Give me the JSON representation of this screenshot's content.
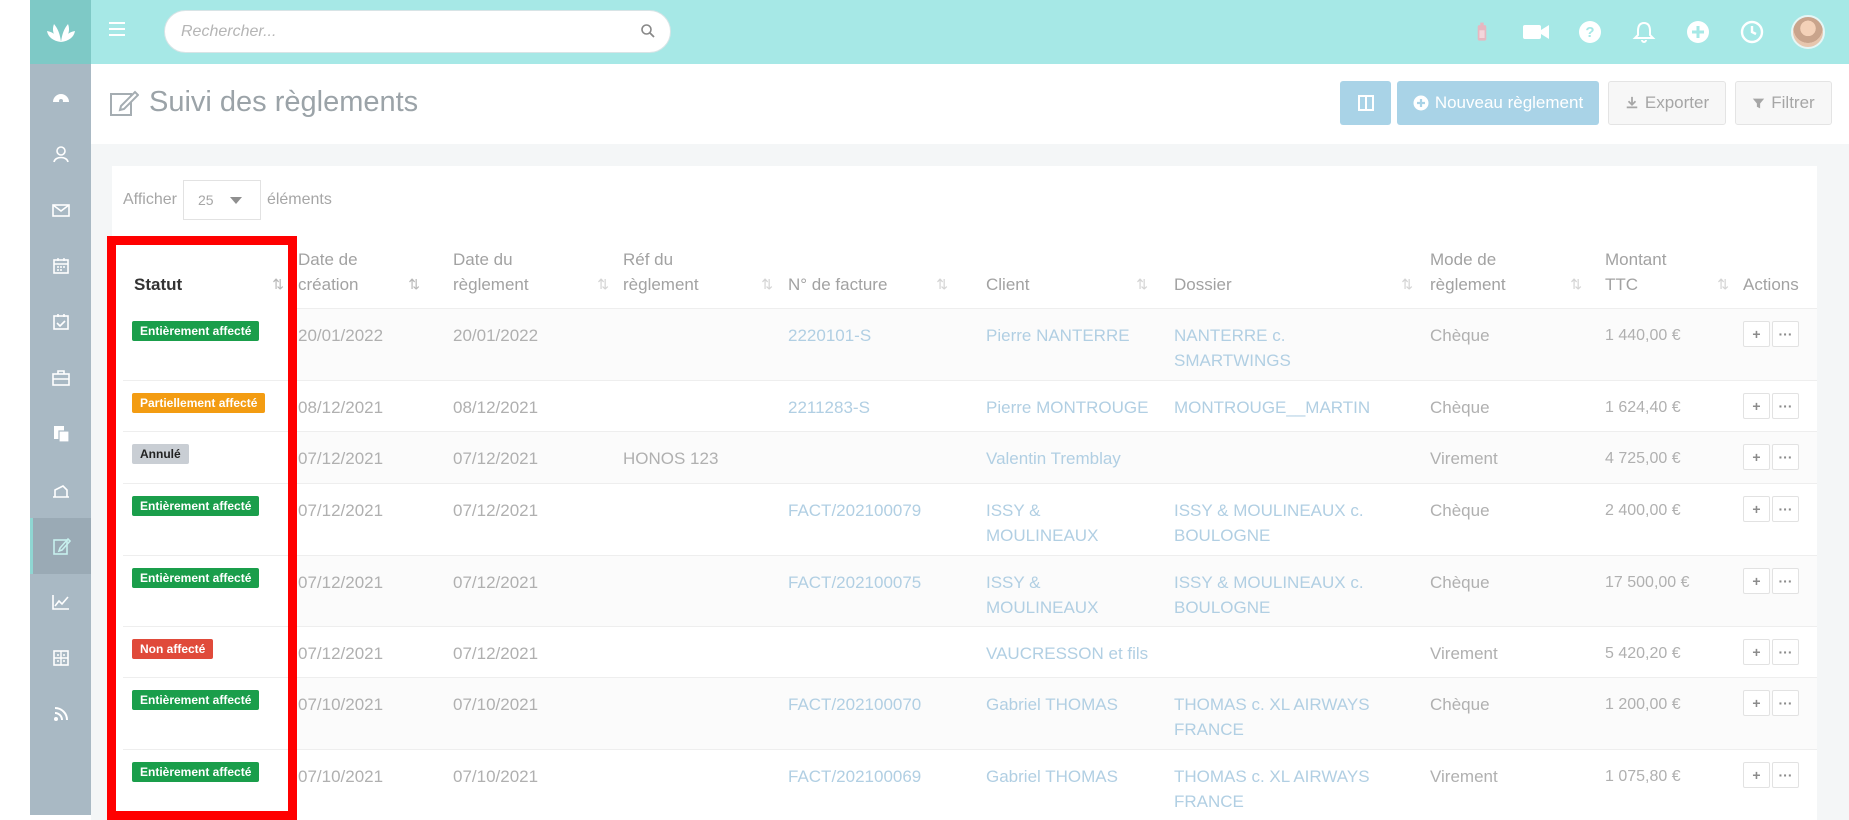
{
  "search": {
    "placeholder": "Rechercher..."
  },
  "page": {
    "title": "Suivi des règlements"
  },
  "toolbar": {
    "new_label": "Nouveau règlement",
    "export_label": "Exporter",
    "filter_label": "Filtrer"
  },
  "length": {
    "before": "Afficher",
    "value": "25",
    "after": "éléments"
  },
  "columns": {
    "statut": "Statut",
    "date_creation_1": "Date de",
    "date_creation_2": "création",
    "date_reglement_1": "Date du",
    "date_reglement_2": "règlement",
    "ref_1": "Réf du",
    "ref_2": "règlement",
    "facture": "N° de facture",
    "client": "Client",
    "dossier": "Dossier",
    "mode_1": "Mode de",
    "mode_2": "règlement",
    "montant_1": "Montant",
    "montant_2": "TTC",
    "actions": "Actions"
  },
  "sort_icon": "⇅",
  "rows": [
    {
      "statut": "Entièrement affecté",
      "statut_color": "#1a9e4b",
      "creation": "20/01/2022",
      "reglement": "20/01/2022",
      "ref": "",
      "facture": "2220101-S",
      "client_1": "Pierre NANTERRE",
      "client_2": "",
      "dossier_1": "NANTERRE c.",
      "dossier_2": "SMARTWINGS",
      "mode": "Chèque",
      "montant": "1 440,00 €"
    },
    {
      "statut": "Partiellement affecté",
      "statut_color": "#f39c12",
      "creation": "08/12/2021",
      "reglement": "08/12/2021",
      "ref": "",
      "facture": "2211283-S",
      "client_1": "Pierre MONTROUGE",
      "client_2": "",
      "dossier_1": "MONTROUGE__MARTIN",
      "dossier_2": "",
      "mode": "Chèque",
      "montant": "1 624,40 €"
    },
    {
      "statut": "Annulé",
      "statut_color": "#c9ced4",
      "creation": "07/12/2021",
      "reglement": "07/12/2021",
      "ref": "HONOS 123",
      "facture": "",
      "client_1": "Valentin Tremblay",
      "client_2": "",
      "dossier_1": "",
      "dossier_2": "",
      "mode": "Virement",
      "montant": "4 725,00 €"
    },
    {
      "statut": "Entièrement affecté",
      "statut_color": "#1a9e4b",
      "creation": "07/12/2021",
      "reglement": "07/12/2021",
      "ref": "",
      "facture": "FACT/202100079",
      "client_1": "ISSY &",
      "client_2": "MOULINEAUX",
      "dossier_1": "ISSY & MOULINEAUX c.",
      "dossier_2": "BOULOGNE",
      "mode": "Chèque",
      "montant": "2 400,00 €"
    },
    {
      "statut": "Entièrement affecté",
      "statut_color": "#1a9e4b",
      "creation": "07/12/2021",
      "reglement": "07/12/2021",
      "ref": "",
      "facture": "FACT/202100075",
      "client_1": "ISSY &",
      "client_2": "MOULINEAUX",
      "dossier_1": "ISSY & MOULINEAUX c.",
      "dossier_2": "BOULOGNE",
      "mode": "Chèque",
      "montant": "17 500,00 €"
    },
    {
      "statut": "Non affecté",
      "statut_color": "#e04a3a",
      "creation": "07/12/2021",
      "reglement": "07/12/2021",
      "ref": "",
      "facture": "",
      "client_1": "VAUCRESSON et fils",
      "client_2": "",
      "dossier_1": "",
      "dossier_2": "",
      "mode": "Virement",
      "montant": "5 420,20 €"
    },
    {
      "statut": "Entièrement affecté",
      "statut_color": "#1a9e4b",
      "creation": "07/10/2021",
      "reglement": "07/10/2021",
      "ref": "",
      "facture": "FACT/202100070",
      "client_1": "Gabriel THOMAS",
      "client_2": "",
      "dossier_1": "THOMAS c. XL AIRWAYS",
      "dossier_2": "FRANCE",
      "mode": "Chèque",
      "montant": "1 200,00 €"
    },
    {
      "statut": "Entièrement affecté",
      "statut_color": "#1a9e4b",
      "creation": "07/10/2021",
      "reglement": "07/10/2021",
      "ref": "",
      "facture": "FACT/202100069",
      "client_1": "Gabriel THOMAS",
      "client_2": "",
      "dossier_1": "THOMAS c. XL AIRWAYS",
      "dossier_2": "FRANCE",
      "mode": "Virement",
      "montant": "1 075,80 €"
    }
  ],
  "colors": {
    "topbar": "#a6e8e6",
    "sidebar": "#a9b9c4",
    "primary_button": "#a9d3e7",
    "link": "#b1cfe3",
    "highlight": "#ff0000"
  },
  "icons": {
    "sidebar": [
      "dashboard-icon",
      "contacts-icon",
      "mail-icon",
      "calendar-icon",
      "tasks-icon",
      "briefcase-icon",
      "documents-icon",
      "billing-icon",
      "payments-icon",
      "stats-icon",
      "calculator-icon",
      "rss-icon"
    ],
    "topbar": [
      "timer-icon",
      "video-icon",
      "help-icon",
      "bell-icon",
      "plus-circle-icon",
      "clock-icon"
    ]
  }
}
